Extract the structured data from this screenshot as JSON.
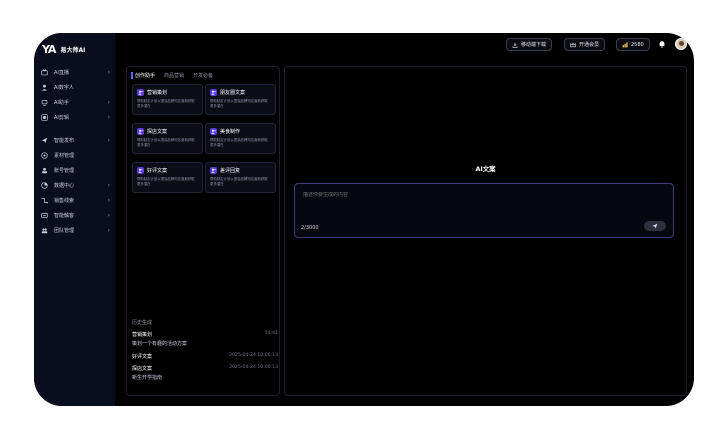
{
  "app": {
    "logo_mark": "YA",
    "name": "易大师AI"
  },
  "sidebar": {
    "items": [
      {
        "label": "AI直播",
        "icon": "live-icon",
        "chevron": "›"
      },
      {
        "label": "AI数字人",
        "icon": "digital-human-icon",
        "chevron": ""
      },
      {
        "label": "AI助手",
        "icon": "assistant-icon",
        "chevron": "›"
      },
      {
        "label": "AI剪辑",
        "icon": "edit-icon",
        "chevron": "›"
      },
      {
        "label": "智能发布",
        "icon": "send-icon",
        "chevron": "›"
      },
      {
        "label": "素材管理",
        "icon": "material-icon",
        "chevron": ""
      },
      {
        "label": "账号管理",
        "icon": "account-icon",
        "chevron": ""
      },
      {
        "label": "数据中心",
        "icon": "data-icon",
        "chevron": "›"
      },
      {
        "label": "销售线索",
        "icon": "leads-icon",
        "chevron": "›"
      },
      {
        "label": "智能触客",
        "icon": "reach-icon",
        "chevron": "›"
      },
      {
        "label": "团队管理",
        "icon": "team-icon",
        "chevron": "›"
      }
    ]
  },
  "topbar": {
    "mobile_download": "移动端下载",
    "vip": "开通会员",
    "coins": "2580"
  },
  "left_panel": {
    "tabs": [
      "创作助手",
      "商品营销",
      "开发必备"
    ],
    "cards": [
      {
        "title": "营销策划",
        "desc": "帮助制定计划以提高品牌知名度和获取更多潜在"
      },
      {
        "title": "朋友圈文案",
        "desc": "帮助制定计划以提高品牌知名度和获取更多潜在"
      },
      {
        "title": "探店文案",
        "desc": "帮助制定计划以提高品牌知名度和获取更多潜在"
      },
      {
        "title": "美食制作",
        "desc": "帮助制定计划以提高品牌知名度和获取更多潜在"
      },
      {
        "title": "好评文案",
        "desc": "帮助制定计划以提高品牌知名度和获取更多潜在"
      },
      {
        "title": "差评回复",
        "desc": "帮助制定计划以提高品牌知名度和获取更多潜在"
      }
    ],
    "history_title": "历史生成",
    "history": [
      {
        "name": "营销策划",
        "time": "14:41",
        "sub": "策划一个有趣的活动方案"
      },
      {
        "name": "好评文案",
        "time": "2025-04-24 10:06:13",
        "sub": ""
      },
      {
        "name": "探店文案",
        "time": "2025-04-24 10:06:13",
        "sub": "新生开学指南"
      }
    ]
  },
  "main": {
    "title": "AI文案",
    "input_placeholder": "描述你要生成的内容",
    "char_count": "2/3000"
  },
  "colors": {
    "accent": "#5c6cff",
    "card_icon": "#5a3bd6",
    "sidebar_bg": "#0a0d1d"
  }
}
